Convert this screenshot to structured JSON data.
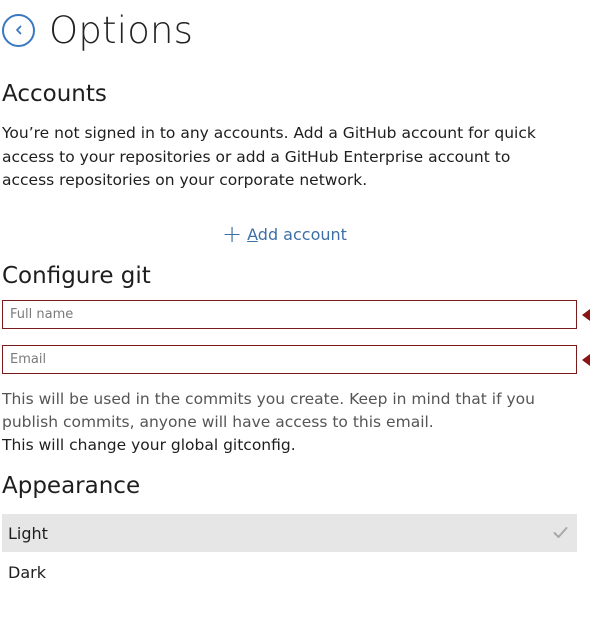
{
  "header": {
    "title": "Options",
    "back_icon": "chevron-left-icon"
  },
  "accounts": {
    "heading": "Accounts",
    "description": "You’re not signed in to any accounts. Add a GitHub account for quick access to your repositories or add a GitHub Enterprise account to access repositories on your corporate network.",
    "add_account_access_key": "A",
    "add_account_rest": "dd account",
    "add_icon": "plus-icon"
  },
  "git": {
    "heading": "Configure git",
    "full_name_placeholder": "Full name",
    "full_name_value": "",
    "email_placeholder": "Email",
    "email_value": "",
    "note": "This will be used in the commits you create. Keep in mind that if you publish commits, anyone will have access to this email.",
    "global_note": "This will change your global gitconfig.",
    "error_color": "#7a1b1b"
  },
  "appearance": {
    "heading": "Appearance",
    "options": [
      {
        "label": "Light",
        "selected": true
      },
      {
        "label": "Dark",
        "selected": false
      }
    ],
    "selected_icon": "checkmark-icon"
  },
  "colors": {
    "accent": "#3a78c2",
    "selected_bg": "#e6e6e6"
  }
}
